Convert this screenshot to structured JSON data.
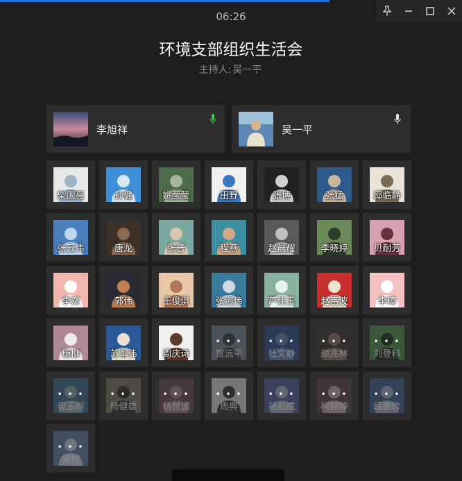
{
  "window": {
    "timer": "06:26",
    "title": "环境支部组织生活会",
    "host_label": "主持人:",
    "host_name": "吴一平"
  },
  "colors": {
    "accent": "#1e6fe0",
    "mic_active": "#3ccb4a",
    "background": "#1e1e1e",
    "tile": "#2d2d2d"
  },
  "speakers": [
    {
      "name": "李旭祥",
      "mic": "green-mic-icon"
    },
    {
      "name": "吴一平",
      "mic": "white-mic-icon"
    }
  ],
  "participants": [
    {
      "name": "柴国亮",
      "off": false
    },
    {
      "name": "孙健",
      "off": false
    },
    {
      "name": "姚莹莹",
      "off": false
    },
    {
      "name": "田野",
      "off": false
    },
    {
      "name": "张博",
      "off": false
    },
    {
      "name": "张猛",
      "off": false
    },
    {
      "name": "邱临静",
      "off": false
    },
    {
      "name": "张云伟",
      "off": false
    },
    {
      "name": "唐龙",
      "off": false
    },
    {
      "name": "张普",
      "off": false
    },
    {
      "name": "程燕",
      "off": false
    },
    {
      "name": "赵晨耀",
      "off": false
    },
    {
      "name": "李晓婷",
      "off": false
    },
    {
      "name": "贝耐芳",
      "off": false
    },
    {
      "name": "李然",
      "off": false
    },
    {
      "name": "郭伟",
      "off": false
    },
    {
      "name": "王俊淇",
      "off": false
    },
    {
      "name": "张海伟",
      "off": false
    },
    {
      "name": "芦佳玉",
      "off": false
    },
    {
      "name": "赵富波",
      "off": false
    },
    {
      "name": "李璋",
      "off": false
    },
    {
      "name": "杨柳",
      "off": false
    },
    {
      "name": "苏军伟",
      "off": false
    },
    {
      "name": "周庆诗",
      "off": false
    },
    {
      "name": "贺沅平",
      "off": true
    },
    {
      "name": "杜文静",
      "off": true
    },
    {
      "name": "颜兆林",
      "off": true
    },
    {
      "name": "刘登科",
      "off": true
    },
    {
      "name": "毋玉同",
      "off": true
    },
    {
      "name": "杨健雄",
      "off": true
    },
    {
      "name": "杨世通",
      "off": true
    },
    {
      "name": "周典",
      "off": true
    },
    {
      "name": "孙彭成",
      "off": true
    },
    {
      "name": "柯婷婷",
      "off": true
    },
    {
      "name": "段鹏珍",
      "off": true
    },
    {
      "name": "常悦",
      "off": true
    }
  ],
  "connecting_indicator": "• • •"
}
